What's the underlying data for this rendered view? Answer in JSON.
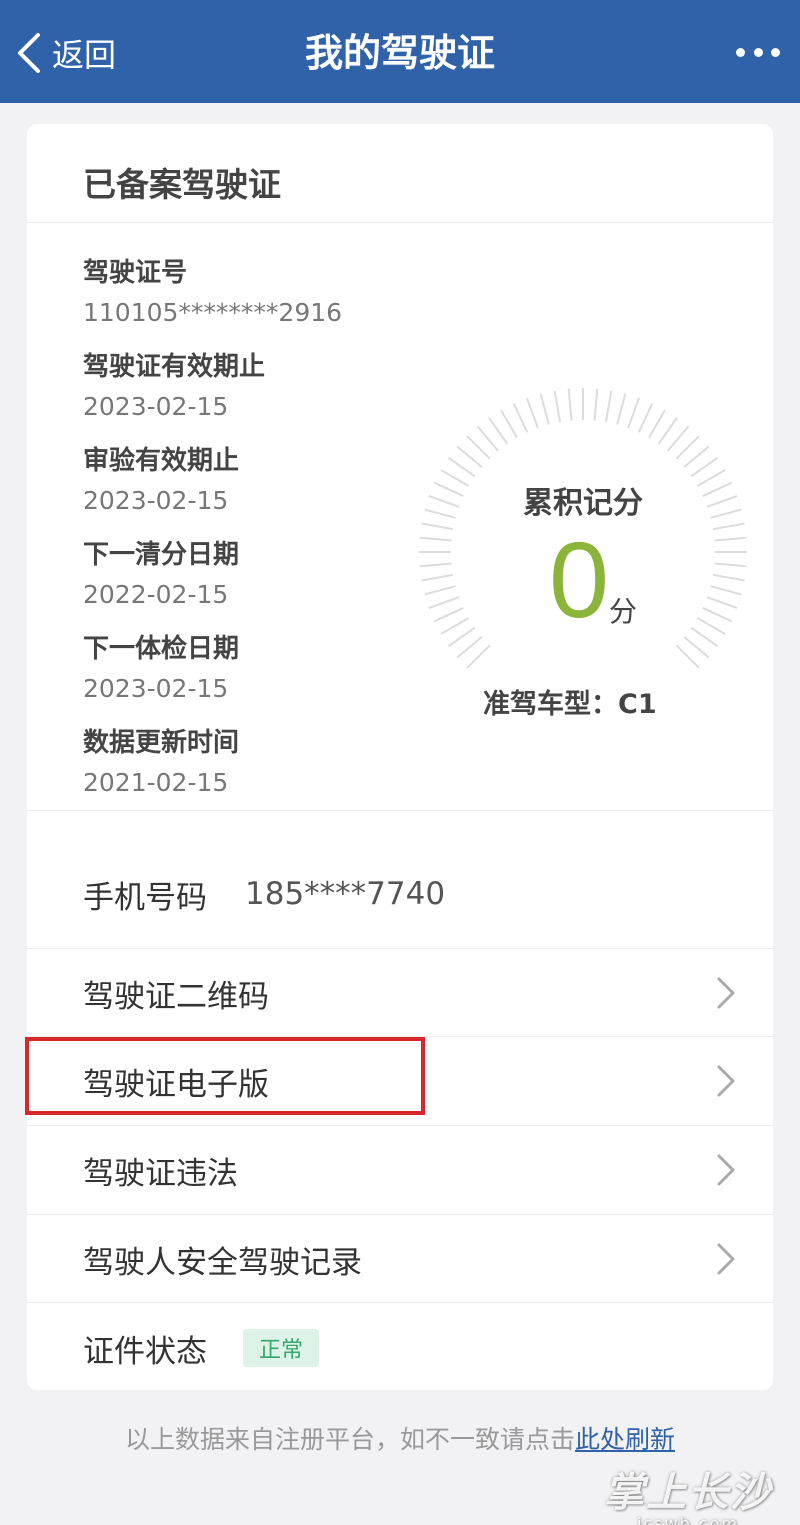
{
  "header": {
    "back_label": "返回",
    "title": "我的驾驶证"
  },
  "card": {
    "title": "已备案驾驶证",
    "fields": [
      {
        "label": "驾驶证号",
        "value": "110105********2916"
      },
      {
        "label": "驾驶证有效期止",
        "value": "2023-02-15"
      },
      {
        "label": "审验有效期止",
        "value": "2023-02-15"
      },
      {
        "label": "下一清分日期",
        "value": "2022-02-15"
      },
      {
        "label": "下一体检日期",
        "value": "2023-02-15"
      },
      {
        "label": "数据更新时间",
        "value": "2021-02-15"
      }
    ],
    "score": {
      "label": "累积记分",
      "value": "0",
      "unit": "分"
    },
    "car_type": "准驾车型：C1",
    "phone": {
      "label": "手机号码",
      "value": "185****7740"
    },
    "menu": [
      {
        "label": "驾驶证二维码"
      },
      {
        "label": "驾驶证电子版"
      },
      {
        "label": "驾驶证违法"
      },
      {
        "label": "驾驶人安全驾驶记录"
      }
    ],
    "status": {
      "label": "证件状态",
      "badge": "正常"
    }
  },
  "footer": {
    "text": "以上数据来自注册平台，如不一致请点击",
    "link": "此处刷新"
  },
  "watermark": {
    "main": "掌上长沙",
    "sub": "icswb.com"
  },
  "colors": {
    "header": "#2f62a8",
    "score": "#8bb53a",
    "highlight": "#d8262c",
    "badge_bg": "#ddf3e7",
    "badge_text": "#34a66d",
    "link": "#2f62a8"
  }
}
